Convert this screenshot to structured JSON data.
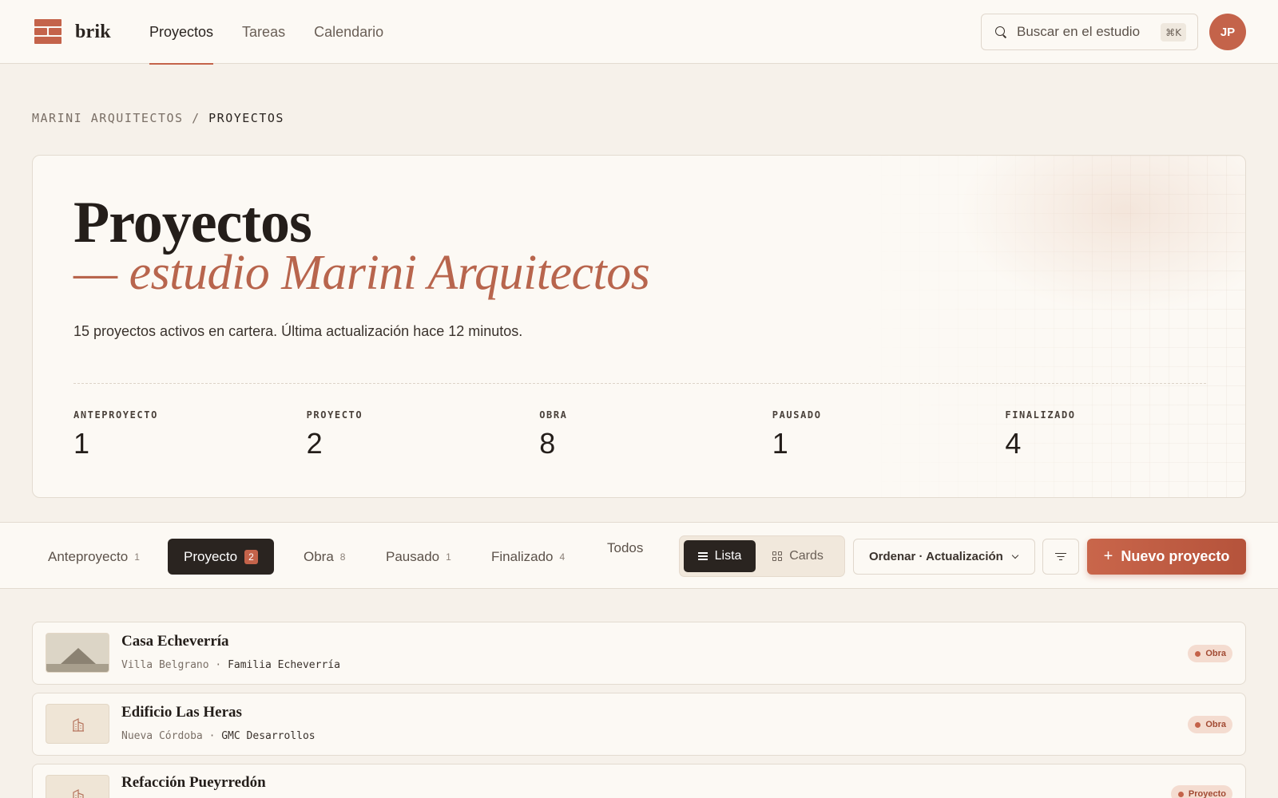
{
  "app": {
    "name": "brik",
    "user_initials": "JP"
  },
  "nav": [
    {
      "label": "Proyectos",
      "active": true
    },
    {
      "label": "Tareas",
      "active": false
    },
    {
      "label": "Calendario",
      "active": false
    }
  ],
  "search": {
    "placeholder": "Buscar en el estudio",
    "shortcut": "⌘K"
  },
  "breadcrumb": {
    "parent": "MARINI ARQUITECTOS",
    "separator": "/",
    "current": "PROYECTOS"
  },
  "hero": {
    "title": "Proyectos",
    "subtitle": "— estudio Marini Arquitectos",
    "description": "15 proyectos activos en cartera. Última actualización hace 12 minutos.",
    "stats": [
      {
        "label": "ANTEPROYECTO",
        "value": "1"
      },
      {
        "label": "PROYECTO",
        "value": "2"
      },
      {
        "label": "OBRA",
        "value": "8"
      },
      {
        "label": "PAUSADO",
        "value": "1"
      },
      {
        "label": "FINALIZADO",
        "value": "4"
      }
    ]
  },
  "filters": [
    {
      "label": "Anteproyecto",
      "count": "1",
      "active": false
    },
    {
      "label": "Proyecto",
      "count": "2",
      "active": true
    },
    {
      "label": "Obra",
      "count": "8",
      "active": false
    },
    {
      "label": "Pausado",
      "count": "1",
      "active": false
    },
    {
      "label": "Finalizado",
      "count": "4",
      "active": false
    },
    {
      "label": "Todos",
      "count": "",
      "active": false
    }
  ],
  "view_toggle": {
    "list_label": "Lista",
    "cards_label": "Cards",
    "selected": "Lista"
  },
  "sort": {
    "label": "Ordenar · Actualización"
  },
  "new_button": {
    "label": "Nuevo proyecto"
  },
  "projects": [
    {
      "name": "Casa Echeverría",
      "location": "Villa Belgrano",
      "client": "Familia Echeverría",
      "status": "Obra",
      "thumb": "landscape"
    },
    {
      "name": "Edificio Las Heras",
      "location": "Nueva Córdoba",
      "client": "GMC Desarrollos",
      "status": "Obra",
      "thumb": "building"
    },
    {
      "name": "Refacción Pueyrredón",
      "location": "",
      "client": "",
      "status": "Proyecto",
      "thumb": "building"
    }
  ],
  "colors": {
    "accent": "#c4634a",
    "dark": "#2a2420",
    "background": "#f6f1ea",
    "surface": "#fcf9f4"
  }
}
